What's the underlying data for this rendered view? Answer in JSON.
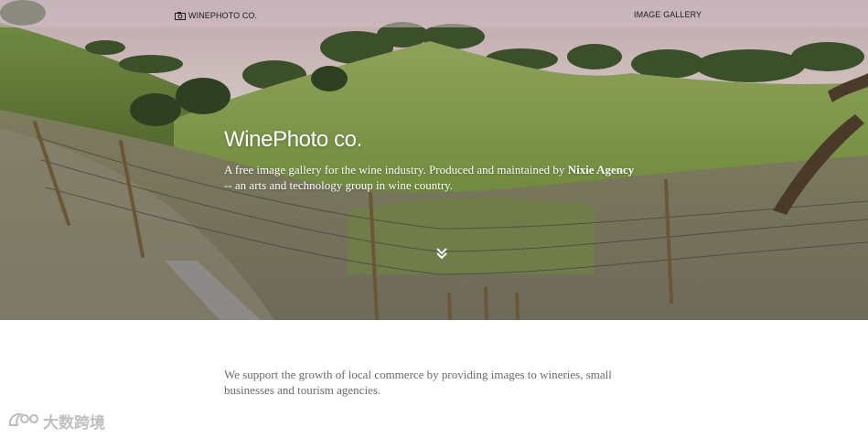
{
  "header": {
    "brand_label": "WINEPHOTO CO.",
    "brand_icon": "camera-icon",
    "nav_gallery_label": "IMAGE GALLERY"
  },
  "hero": {
    "title": "WinePhoto co.",
    "description_before": "A free image gallery for the wine industry. Produced and maintained by ",
    "description_link": "Nixie Agency",
    "description_after": " -- an arts and technology group in wine country.",
    "scroll_icon": "double-chevron-down-icon"
  },
  "content": {
    "mission": "We support the growth of local commerce by providing images to wineries, small businesses and tourism agencies."
  },
  "watermark": {
    "text": "大数跨境"
  },
  "colors": {
    "topbar": "#cdbec4",
    "hero_text": "#ffffff",
    "body_text": "#6b6b6b"
  }
}
